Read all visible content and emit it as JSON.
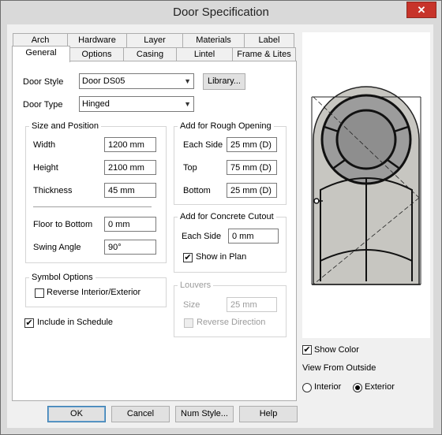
{
  "window": {
    "title": "Door Specification",
    "close_glyph": "✕"
  },
  "tabs": {
    "row1": [
      "Arch",
      "Hardware",
      "Layer",
      "Materials",
      "Label"
    ],
    "row2": [
      "General",
      "Options",
      "Casing",
      "Lintel",
      "Frame & Lites"
    ],
    "active": "General"
  },
  "general": {
    "door_style_label": "Door Style",
    "door_style_value": "Door DS05",
    "library_button": "Library...",
    "door_type_label": "Door Type",
    "door_type_value": "Hinged"
  },
  "size_position": {
    "title": "Size and Position",
    "width_label": "Width",
    "width_value": "1200 mm",
    "height_label": "Height",
    "height_value": "2100 mm",
    "thickness_label": "Thickness",
    "thickness_value": "45 mm",
    "floor_label": "Floor to Bottom",
    "floor_value": "0 mm",
    "swing_label": "Swing Angle",
    "swing_value": "90°"
  },
  "rough_opening": {
    "title": "Add for Rough Opening",
    "each_side_label": "Each Side",
    "each_side_value": "25 mm (D)",
    "top_label": "Top",
    "top_value": "75 mm (D)",
    "bottom_label": "Bottom",
    "bottom_value": "25 mm (D)"
  },
  "concrete_cutout": {
    "title": "Add for Concrete Cutout",
    "each_side_label": "Each Side",
    "each_side_value": "0 mm",
    "show_in_plan_label": "Show in Plan",
    "show_in_plan_checked": true
  },
  "symbol_options": {
    "title": "Symbol Options",
    "reverse_label": "Reverse Interior/Exterior",
    "reverse_checked": false
  },
  "louvers": {
    "title": "Louvers",
    "size_label": "Size",
    "size_value": "25 mm",
    "reverse_direction_label": "Reverse Direction",
    "reverse_direction_checked": false
  },
  "include_schedule": {
    "label": "Include in Schedule",
    "checked": true
  },
  "preview_panel": {
    "show_color_label": "Show Color",
    "show_color_checked": true,
    "view_from_label": "View From Outside",
    "interior_label": "Interior",
    "exterior_label": "Exterior",
    "selected": "Exterior"
  },
  "footer": {
    "ok": "OK",
    "cancel": "Cancel",
    "num_style": "Num Style...",
    "help": "Help"
  },
  "colors": {
    "door_fill": "#c7c6c1",
    "line": "#222222",
    "accent": "#3c7fb1"
  },
  "check_glyph": "✔"
}
